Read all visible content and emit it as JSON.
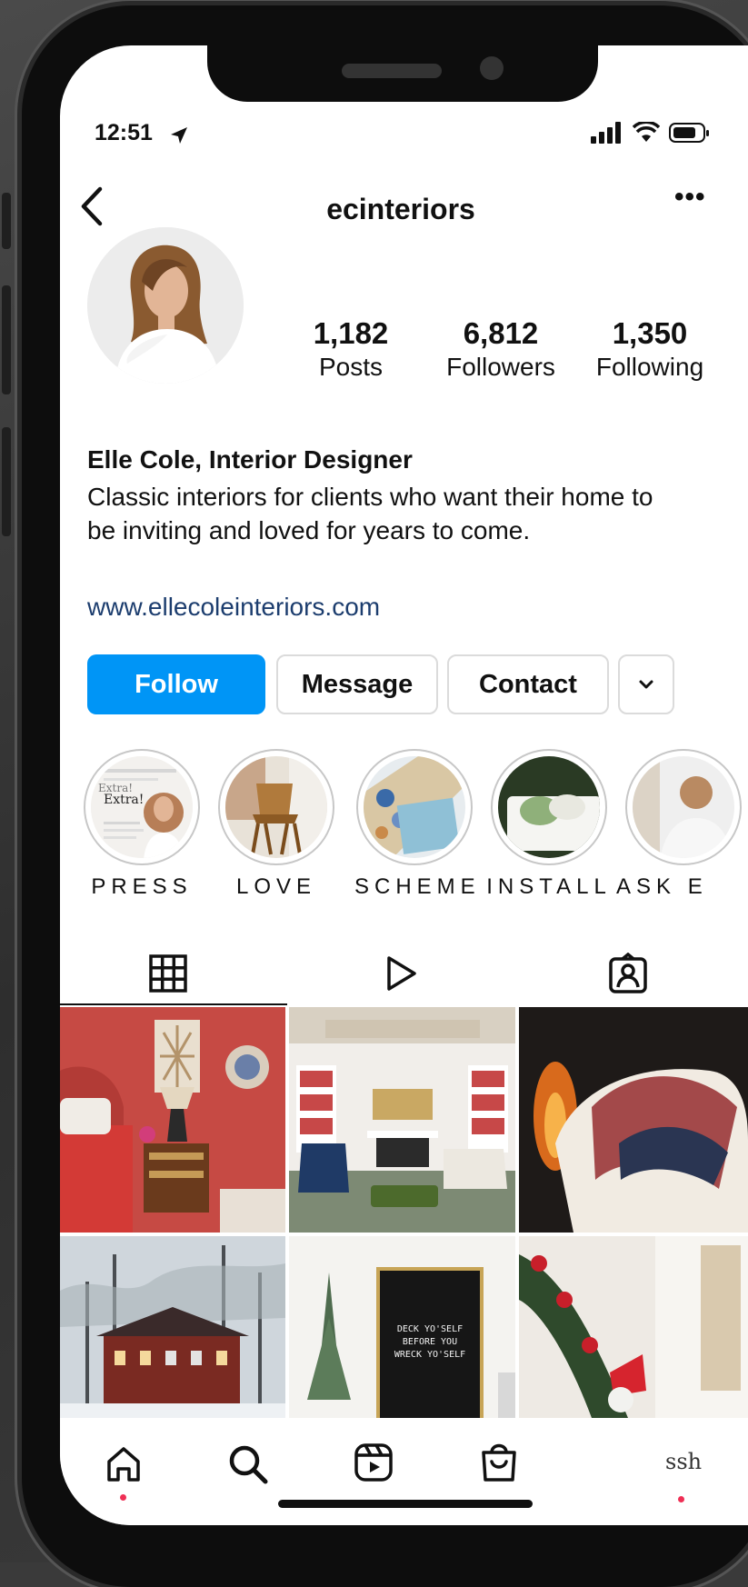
{
  "status_bar": {
    "time": "12:51"
  },
  "header": {
    "username": "ecinteriors"
  },
  "stats": [
    {
      "value": "1,182",
      "label": "Posts"
    },
    {
      "value": "6,812",
      "label": "Followers"
    },
    {
      "value": "1,350",
      "label": "Following"
    }
  ],
  "profile": {
    "name": "Elle Cole, Interior Designer",
    "bio": "Classic interiors for clients who want their home to be inviting and loved for years to come.",
    "website": "www.ellecoleinteriors.com"
  },
  "actions": {
    "follow": "Follow",
    "message": "Message",
    "contact": "Contact"
  },
  "highlights": [
    {
      "label": "PRESS"
    },
    {
      "label": "LOVE"
    },
    {
      "label": "SCHEME"
    },
    {
      "label": "INSTALL"
    },
    {
      "label": "ASK E"
    }
  ],
  "highlight_thumb_text": {
    "extra": "Extra!",
    "extra2": "Extra!"
  },
  "posts": {
    "letterboard": [
      "DECK YO'SELF",
      "BEFORE YOU",
      "WRECK YO'SELF"
    ]
  },
  "bottom_nav": {
    "profile_label": "ssh"
  },
  "colors": {
    "accent": "#0095f6",
    "link": "#1c3d6e",
    "notification_dot": "#ef2f55"
  }
}
